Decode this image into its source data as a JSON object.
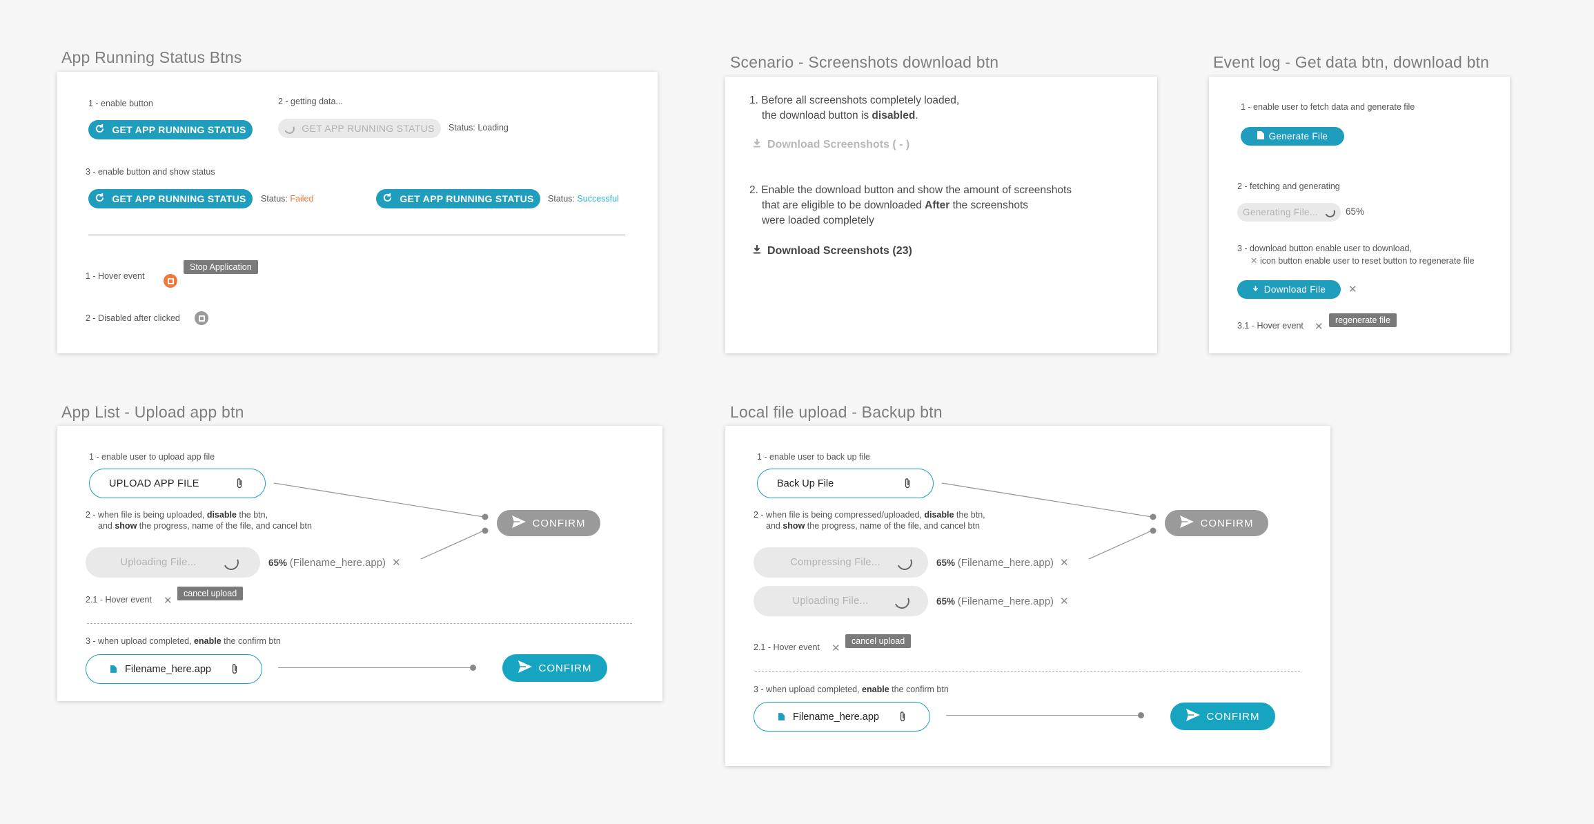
{
  "colors": {
    "accent": "#1f9dbd",
    "failed": "#ef7a3c",
    "success": "#2ab4d3",
    "stop": "#ef7a3c"
  },
  "sec1": {
    "title": "App Running Status Btns",
    "s1_label": "1 - enable button",
    "btn_label": "GET APP RUNNING STATUS",
    "s2_label": "2 - getting data...",
    "status_loading": "Status: Loading",
    "s3_label": "3 - enable button and show status",
    "status_prefix": "Status:",
    "status_failed": "Failed",
    "status_successful": "Successful",
    "hover_label": "1 - Hover event",
    "tooltip": "Stop Application",
    "disabled_label": "2 - Disabled after clicked"
  },
  "sec2": {
    "title": "Scenario - Screenshots download btn",
    "p1_line1": "1. Before all screenshots completely loaded,",
    "p1_line2_pre": "the download button is ",
    "p1_line2_bold": "disabled",
    "p1_line2_post": ".",
    "dl_disabled": "Download Screenshots ( - )",
    "p2_line1": "2. Enable the download button and show the amount of screenshots",
    "p2_line2_pre": "that are eligible to be downloaded ",
    "p2_line2_bold": "After",
    "p2_line2_post": " the screenshots",
    "p2_line3": "were loaded completely",
    "dl_enabled": "Download Screenshots (23)"
  },
  "sec3": {
    "title": "Event log - Get data btn, download btn",
    "s1_label": "1 - enable user to fetch data and generate file",
    "generate_label": "Generate File",
    "s2_label": "2 - fetching and generating",
    "generating_label": "Generating File...",
    "progress": "65%",
    "s3_line1": "3 - download button enable user to download,",
    "s3_line2": "icon button enable user to reset button to regenerate file",
    "download_label": "Download File",
    "hover_label": "3.1 - Hover event",
    "tooltip": "regenerate file"
  },
  "sec4": {
    "title": "App List - Upload app btn",
    "s1_label": "1 - enable user to upload app file",
    "upload_label": "UPLOAD APP FILE",
    "s2_line1_pre": "2 - when file is being uploaded, ",
    "s2_line1_bold": "disable",
    "s2_line1_post": " the btn,",
    "s2_line2_pre": "and ",
    "s2_line2_bold": "show",
    "s2_line2_post": " the progress, name of the file, and cancel btn",
    "uploading_label": "Uploading File...",
    "progress": "65%",
    "filename_paren": "(Filename_here.app)",
    "confirm": "CONFIRM",
    "hover_label": "2.1 - Hover event",
    "tooltip": "cancel upload",
    "s3_pre": "3 - when upload completed, ",
    "s3_bold": "enable",
    "s3_post": " the confirm btn",
    "filename": "Filename_here.app"
  },
  "sec5": {
    "title": "Local file upload - Backup btn",
    "s1_label": "1 - enable user to back up file",
    "backup_label": "Back Up File",
    "s2_line1_pre": "2 - when file is being compressed/uploaded, ",
    "s2_line1_bold": "disable",
    "s2_line1_post": " the btn,",
    "s2_line2_pre": "and ",
    "s2_line2_bold": "show",
    "s2_line2_post": " the progress, name of the file, and cancel btn",
    "compressing_label": "Compressing File...",
    "uploading_label": "Uploading File...",
    "progress": "65%",
    "filename_paren": "(Filename_here.app)",
    "confirm": "CONFIRM",
    "hover_label": "2.1 - Hover event",
    "tooltip": "cancel upload",
    "s3_pre": "3 - when upload completed, ",
    "s3_bold": "enable",
    "s3_post": " the confirm btn",
    "filename": "Filename_here.app"
  }
}
